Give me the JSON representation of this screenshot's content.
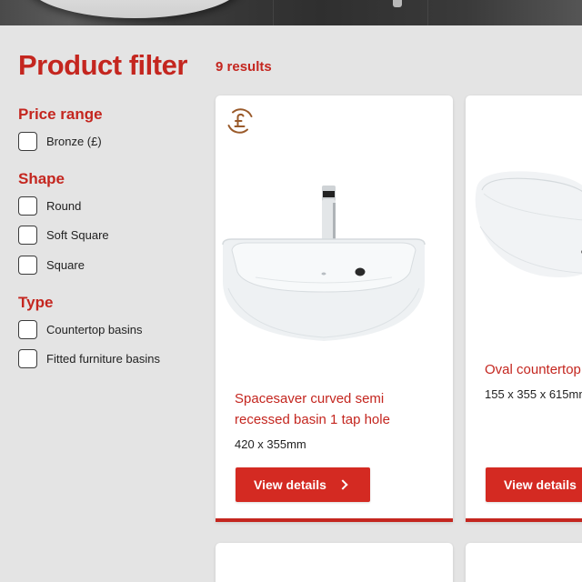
{
  "filter": {
    "title": "Product filter",
    "groups": [
      {
        "title": "Price range",
        "options": [
          {
            "label": "Bronze (£)",
            "checked": false
          }
        ]
      },
      {
        "title": "Shape",
        "options": [
          {
            "label": "Round",
            "checked": false
          },
          {
            "label": "Soft Square",
            "checked": false
          },
          {
            "label": "Square",
            "checked": false
          }
        ]
      },
      {
        "title": "Type",
        "options": [
          {
            "label": "Countertop basins",
            "checked": false
          },
          {
            "label": "Fitted furniture basins",
            "checked": false
          }
        ]
      }
    ]
  },
  "results": {
    "count_label": "9 results"
  },
  "products": [
    {
      "price_icon": "pound-circle-icon",
      "title_line1": "Spacesaver curved semi",
      "title_line2": "recessed basin 1 tap hole",
      "size": "420 x 355mm",
      "button_label": "View details"
    },
    {
      "title_line1": "Oval countertop",
      "size": "155 x 355 x 615mm",
      "button_label": "View details"
    }
  ],
  "colors": {
    "accent": "#c4261f",
    "button": "#d42a22",
    "background": "#e4e4e4",
    "card": "#ffffff"
  }
}
